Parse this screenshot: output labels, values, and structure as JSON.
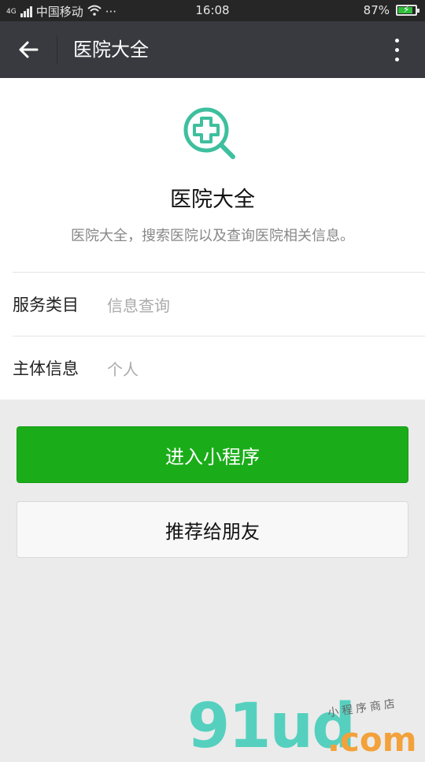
{
  "status_bar": {
    "network": "4G",
    "carrier": "中国移动",
    "dots": "···",
    "time": "16:08",
    "battery": "87%"
  },
  "nav": {
    "title": "医院大全"
  },
  "app": {
    "name": "医院大全",
    "description": "医院大全，搜索医院以及查询医院相关信息。",
    "brand_color": "#3ebf9e"
  },
  "info_rows": [
    {
      "label": "服务类目",
      "value": "信息查询"
    },
    {
      "label": "主体信息",
      "value": "个人"
    }
  ],
  "buttons": {
    "enter_label": "进入小程序",
    "recommend_label": "推荐给朋友"
  },
  "watermark": {
    "brand": "91ud",
    "suffix": ".com",
    "tagline": "小程序商店"
  },
  "colors": {
    "nav_bg": "#393a3f",
    "primary_green": "#1aad19",
    "page_bg": "#ebebeb"
  }
}
